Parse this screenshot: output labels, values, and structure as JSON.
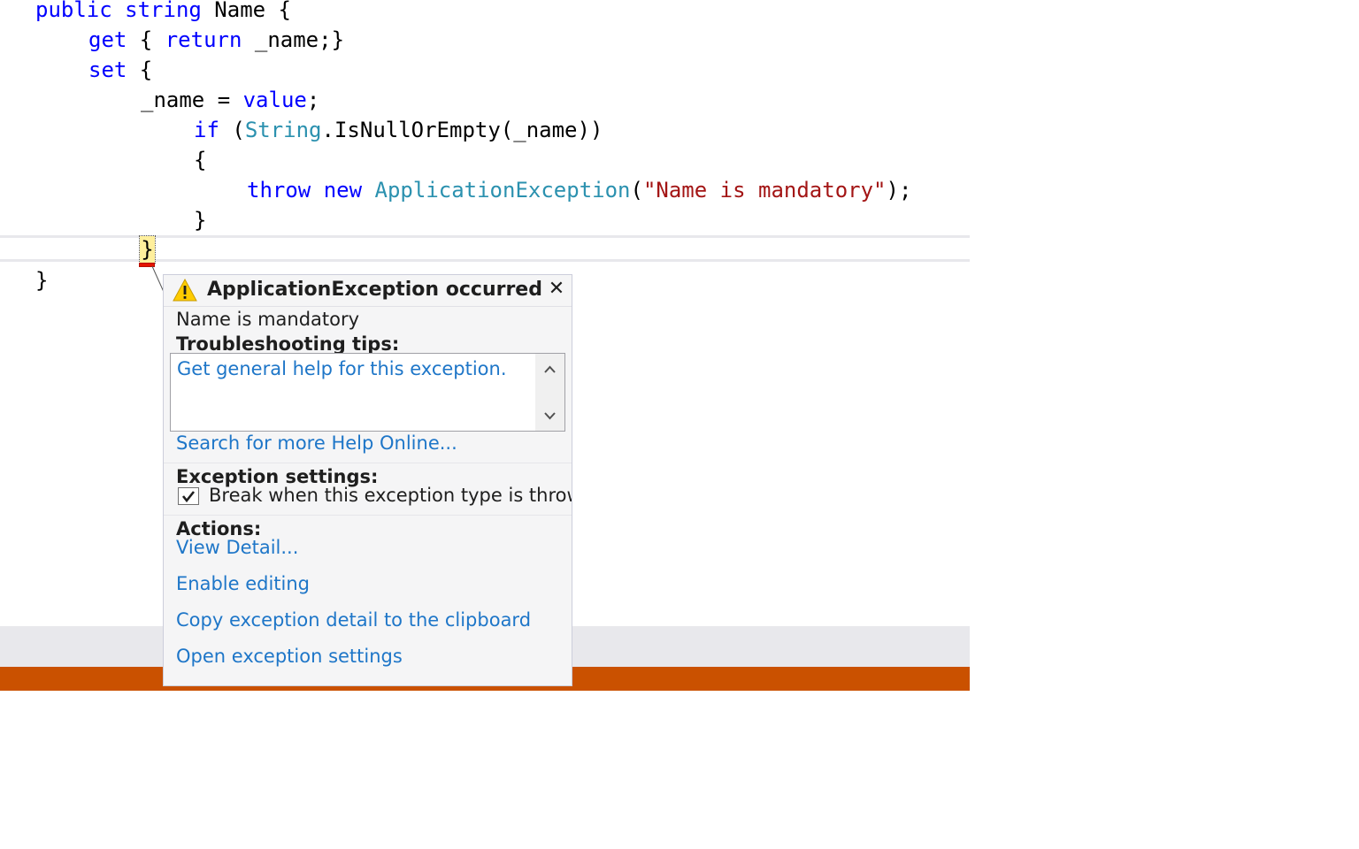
{
  "editor": {
    "lines": [
      {
        "tokens": [
          {
            "t": "public",
            "c": "kw"
          },
          {
            "t": " ",
            "c": "plain"
          },
          {
            "t": "string",
            "c": "kw"
          },
          {
            "t": " Name {",
            "c": "plain"
          }
        ]
      },
      {
        "tokens": [
          {
            "t": "get",
            "c": "kw"
          },
          {
            "t": " { ",
            "c": "plain"
          },
          {
            "t": "return",
            "c": "kw"
          },
          {
            "t": " _name;}",
            "c": "plain"
          }
        ]
      },
      {
        "tokens": [
          {
            "t": "set",
            "c": "kw"
          },
          {
            "t": " {",
            "c": "plain"
          }
        ]
      },
      {
        "tokens": [
          {
            "t": "_name = ",
            "c": "plain"
          },
          {
            "t": "value",
            "c": "kw"
          },
          {
            "t": ";",
            "c": "plain"
          }
        ]
      },
      {
        "tokens": [
          {
            "t": "if",
            "c": "kw"
          },
          {
            "t": " (",
            "c": "plain"
          },
          {
            "t": "String",
            "c": "typ"
          },
          {
            "t": ".IsNullOrEmpty(_name))",
            "c": "plain"
          }
        ]
      },
      {
        "tokens": [
          {
            "t": "{",
            "c": "plain"
          }
        ]
      },
      {
        "tokens": [
          {
            "t": "throw",
            "c": "kw"
          },
          {
            "t": " ",
            "c": "plain"
          },
          {
            "t": "new",
            "c": "kw"
          },
          {
            "t": " ",
            "c": "plain"
          },
          {
            "t": "ApplicationException",
            "c": "typ"
          },
          {
            "t": "(",
            "c": "plain"
          },
          {
            "t": "\"Name is mandatory\"",
            "c": "str"
          },
          {
            "t": ");",
            "c": "plain"
          }
        ]
      },
      {
        "tokens": [
          {
            "t": "}",
            "c": "plain"
          }
        ]
      },
      {
        "tokens": [
          {
            "t": "}",
            "c": "plain"
          }
        ]
      }
    ],
    "current_brace": "}"
  },
  "exception": {
    "title": "ApplicationException occurred",
    "close_glyph": "✕",
    "message": "Name is mandatory",
    "tips_heading": "Troubleshooting tips:",
    "tips": [
      "Get general help for this exception."
    ],
    "search_link": "Search for more Help Online...",
    "settings_heading": "Exception settings:",
    "break_checkbox": {
      "label": "Break when this exception type is thrown",
      "checked": true
    },
    "actions_heading": "Actions:",
    "actions": [
      "View Detail...",
      "Enable editing",
      "Copy exception detail to the clipboard",
      "Open exception settings"
    ]
  },
  "icons": {
    "warning": "warning-icon",
    "close": "close-icon",
    "scroll_up": "chevron-up-icon",
    "scroll_down": "chevron-down-icon",
    "check": "checkmark-icon"
  },
  "colors": {
    "keyword": "#0000ff",
    "type": "#2b91af",
    "string": "#a31515",
    "link": "#1e76c8",
    "status_bar": "#ca5100",
    "warning": "#ffcc00"
  }
}
